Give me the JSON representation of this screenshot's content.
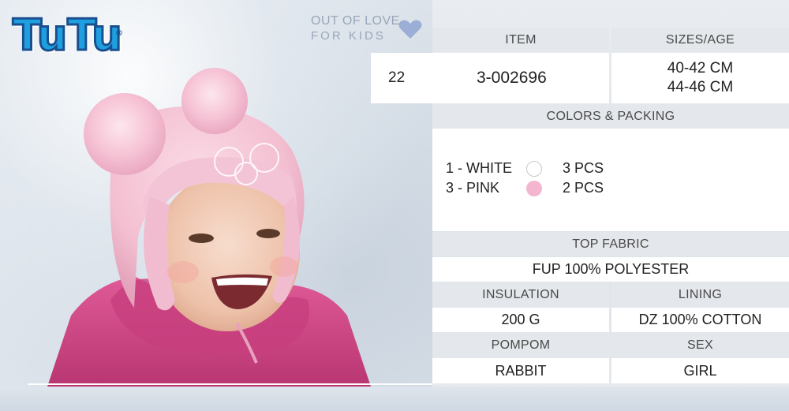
{
  "brand": {
    "logo_text": "TuTu",
    "slogan_line1": "OUT OF LOVE",
    "slogan_line2": "FOR KIDS"
  },
  "product": {
    "number": "22",
    "item_header": "ITEM",
    "item_value": "3-002696",
    "sizes_header": "SIZES/AGE",
    "sizes": [
      "40-42 CM",
      "44-46 CM"
    ]
  },
  "colors_packing": {
    "header": "COLORS & PACKING",
    "items": [
      {
        "label": "1 - WHITE",
        "color": "#ffffff",
        "qty": "3 PCS"
      },
      {
        "label": "3 - PINK",
        "color": "#f4b6cf",
        "qty": "2 PCS"
      }
    ]
  },
  "top_fabric": {
    "header": "TOP FABRIC",
    "value": "FUP 100% POLYESTER"
  },
  "insulation": {
    "header": "INSULATION",
    "value": "200 G"
  },
  "lining": {
    "header": "LINING",
    "value": "DZ 100% COTTON"
  },
  "pompom": {
    "header": "POMPOM",
    "value": "RABBIT"
  },
  "sex": {
    "header": "SEX",
    "value": "GIRL"
  },
  "colors": {
    "logo_blue": "#1ea0e0",
    "logo_outline": "#1a4f8f",
    "slogan": "#9aa6ba",
    "heart": "#9aaed6",
    "header_bg": "#e4e7eb",
    "hat_pink": "#f6c9d8",
    "jacket": "#d14a86"
  },
  "icons": [
    "heart-icon"
  ]
}
